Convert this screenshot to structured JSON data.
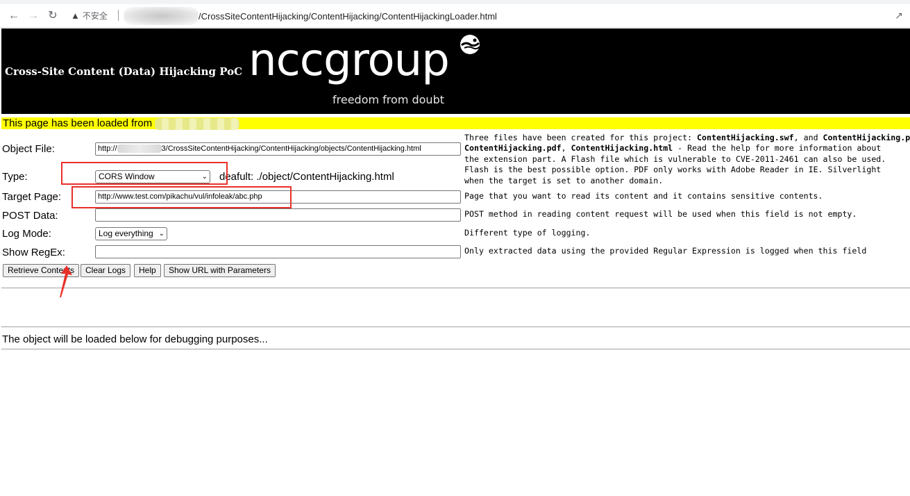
{
  "browser": {
    "security_label": "不安全",
    "url_path": "/CrossSiteContentHijacking/ContentHijacking/ContentHijackingLoader.html"
  },
  "banner": {
    "title": "Cross-Site Content (Data) Hijacking PoC",
    "logo_text": "nccgroup",
    "logo_tagline": "freedom from doubt"
  },
  "loaded_bar": {
    "text": "This page has been loaded from"
  },
  "form": {
    "object_file": {
      "label": "Object File:",
      "value_prefix": "http://",
      "value_suffix": "3/CrossSiteContentHijacking/ContentHijacking/objects/ContentHijacking.html"
    },
    "type": {
      "label": "Type:",
      "selected": "CORS Window",
      "default_note": "deafult: ./object/ContentHijacking.html"
    },
    "target_page": {
      "label": "Target Page:",
      "value": "http://www.test.com/pikachu/vul/infoleak/abc.php"
    },
    "post_data": {
      "label": "POST Data:",
      "value": ""
    },
    "log_mode": {
      "label": "Log Mode:",
      "selected": "Log everything"
    },
    "show_regex": {
      "label": "Show RegEx:",
      "value": ""
    }
  },
  "help": {
    "object_line1_a": "Three files have been created for this project: ",
    "object_line1_b": "ContentHijacking.swf",
    "object_line1_c": ", and ",
    "object_line1_d": "ContentHijacking.pdf",
    "object_line2_a": "ContentHijacking.pdf",
    "object_line2_b": ", ",
    "object_line2_c": "ContentHijacking.html",
    "object_line2_d": " - Read the help for more information about",
    "object_line3": "the extension part. A Flash file which is vulnerable to CVE-2011-2461 can also be used.",
    "object_line4": "Flash is the best possible option. PDF only works with Adobe Reader in IE. Silverlight",
    "object_line5": "when the target is set to another domain.",
    "target": "Page that you want to read its content and it contains sensitive contents.",
    "post": "POST method in reading content request will be used when this field is not empty.",
    "log": "Different type of logging.",
    "regex": "Only extracted data using the provided Regular Expression is logged when this field"
  },
  "buttons": {
    "retrieve": "Retrieve Contents",
    "clear_logs": "Clear Logs",
    "help": "Help",
    "show_url": "Show URL with Parameters"
  },
  "debug_text": "The object will be loaded below for debugging purposes...",
  "colors": {
    "banner": "#000000",
    "loaded_bar": "#ffff00",
    "annotation": "#e8302a"
  }
}
